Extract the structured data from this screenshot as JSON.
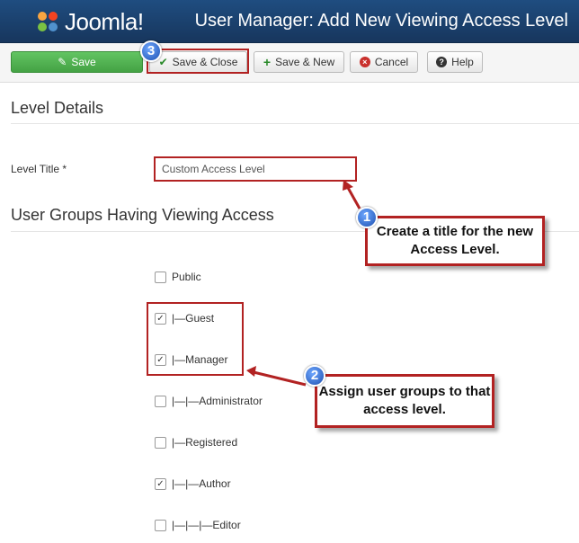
{
  "app": {
    "brand": "Joomla!",
    "page_title": "User Manager: Add New Viewing Access Level"
  },
  "toolbar": {
    "save_label": "Save",
    "save_close_label": "Save & Close",
    "save_new_label": "Save & New",
    "cancel_label": "Cancel",
    "help_label": "Help"
  },
  "form": {
    "section_title": "Level Details",
    "level_title_label": "Level Title *",
    "level_title_value": "Custom Access Level",
    "groups_title": "User Groups Having Viewing Access",
    "groups": [
      {
        "label": "Public",
        "checked": false
      },
      {
        "label": "|—Guest",
        "checked": true
      },
      {
        "label": "|—Manager",
        "checked": true
      },
      {
        "label": "|—|—Administrator",
        "checked": false
      },
      {
        "label": "|—Registered",
        "checked": false
      },
      {
        "label": "|—|—Author",
        "checked": true
      },
      {
        "label": "|—|—|—Editor",
        "checked": false
      }
    ]
  },
  "annotations": {
    "step1_number": "1",
    "step1_text": "Create a title for the new Access Level.",
    "step2_number": "2",
    "step2_text": "Assign user groups to that access level.",
    "step3_number": "3"
  },
  "colors": {
    "header_bg": "#1f4d80",
    "save_green": "#51b351",
    "annotation_red": "#b22222",
    "badge_blue": "#1c4fb0"
  }
}
